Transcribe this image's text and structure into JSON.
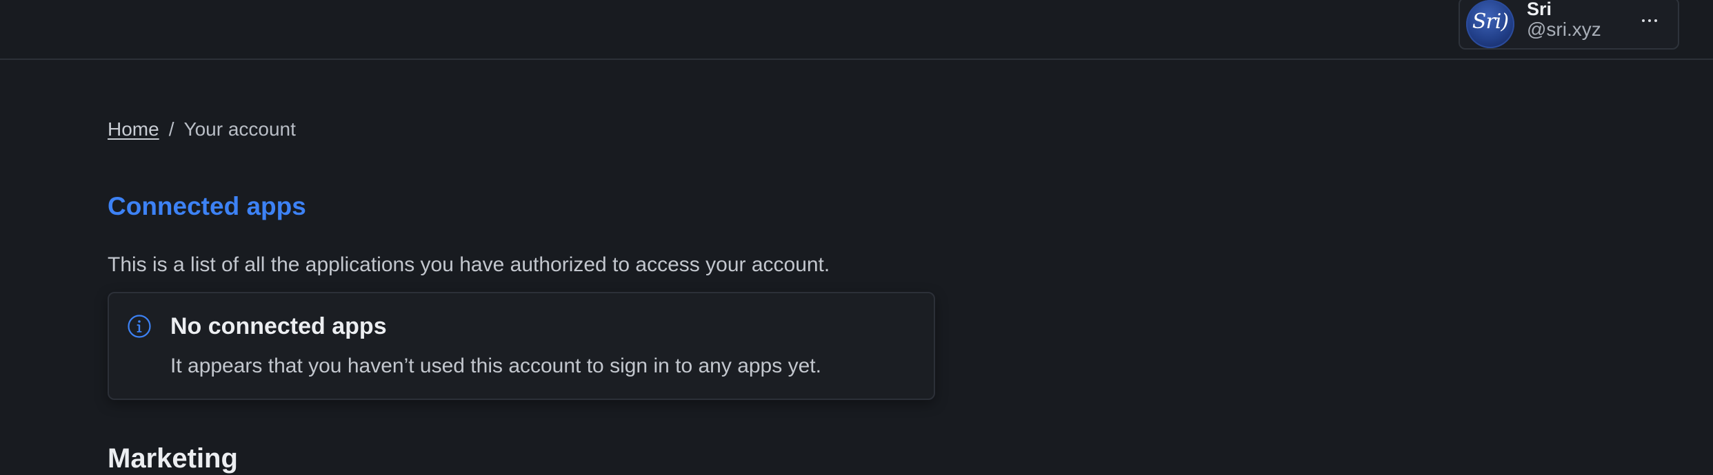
{
  "account": {
    "name": "Sri",
    "handle": "@sri.xyz",
    "avatar_text": "Sri)",
    "more_label": "More options"
  },
  "breadcrumb": {
    "home": "Home",
    "separator": "/",
    "current": "Your account"
  },
  "page": {
    "title": "Connected apps",
    "description": "This is a list of all the applications you have authorized to access your account."
  },
  "notice": {
    "icon": "info-icon",
    "title": "No connected apps",
    "body": "It appears that you haven’t used this account to sign in to any apps yet."
  },
  "next_section": {
    "heading": "Marketing"
  },
  "colors": {
    "background": "#181b20",
    "accent": "#3d82f5",
    "border": "#2c3038"
  }
}
